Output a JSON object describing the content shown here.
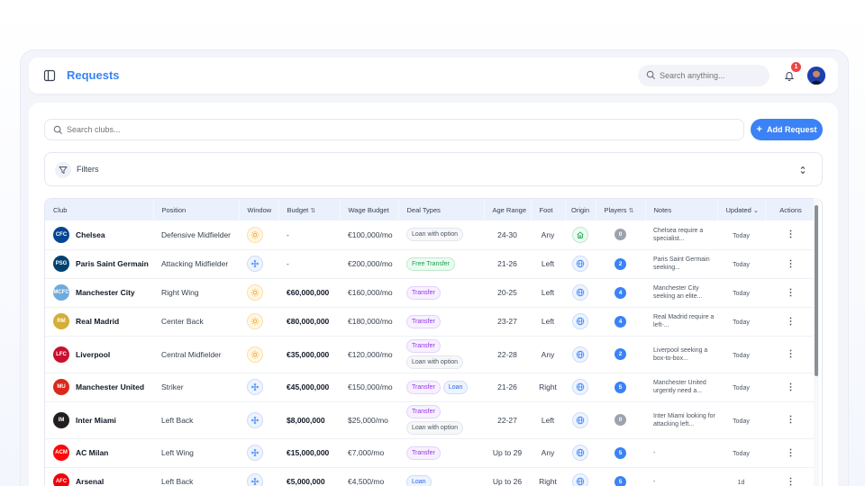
{
  "header": {
    "title": "Requests",
    "search_placeholder": "Search anything...",
    "notification_count": "1"
  },
  "toolbar": {
    "club_search_placeholder": "Search clubs...",
    "add_label": "Add Request",
    "filters_label": "Filters"
  },
  "table": {
    "columns": {
      "club": "Club",
      "position": "Position",
      "window": "Window",
      "budget": "Budget",
      "wage_budget": "Wage Budget",
      "deal_types": "Deal Types",
      "age_range": "Age Range",
      "foot": "Foot",
      "origin": "Origin",
      "players": "Players",
      "notes": "Notes",
      "updated": "Updated",
      "actions": "Actions"
    },
    "rows": [
      {
        "club": "Chelsea",
        "crest_color": "#034694",
        "crest_text": "CFC",
        "position": "Defensive Midfielder",
        "window": "summer",
        "budget": "-",
        "wage": "€100,000/mo",
        "deals": [
          "Loan with option"
        ],
        "age": "24-30",
        "foot": "Any",
        "origin": "home",
        "players": "0",
        "notes": "Chelsea require a specialist...",
        "updated": "Today"
      },
      {
        "club": "Paris Saint Germain",
        "crest_color": "#004170",
        "crest_text": "PSG",
        "position": "Attacking Midfielder",
        "window": "winter",
        "budget": "-",
        "wage": "€200,000/mo",
        "deals": [
          "Free Transfer"
        ],
        "age": "21-26",
        "foot": "Left",
        "origin": "globe",
        "players": "2",
        "notes": "Paris Saint Germain seeking...",
        "updated": "Today"
      },
      {
        "club": "Manchester City",
        "crest_color": "#6CABDD",
        "crest_text": "MCFC",
        "position": "Right Wing",
        "window": "summer",
        "budget": "€60,000,000",
        "wage": "€160,000/mo",
        "deals": [
          "Transfer"
        ],
        "age": "20-25",
        "foot": "Left",
        "origin": "globe",
        "players": "4",
        "notes": "Manchester City seeking an elite...",
        "updated": "Today"
      },
      {
        "club": "Real Madrid",
        "crest_color": "#d4af37",
        "crest_text": "RM",
        "position": "Center Back",
        "window": "summer",
        "budget": "€80,000,000",
        "wage": "€180,000/mo",
        "deals": [
          "Transfer"
        ],
        "age": "23-27",
        "foot": "Left",
        "origin": "globe",
        "players": "4",
        "notes": "Real Madrid require a left-...",
        "updated": "Today"
      },
      {
        "club": "Liverpool",
        "crest_color": "#c8102e",
        "crest_text": "LFC",
        "position": "Central Midfielder",
        "window": "summer",
        "budget": "€35,000,000",
        "wage": "€120,000/mo",
        "deals": [
          "Transfer",
          "Loan with option"
        ],
        "age": "22-28",
        "foot": "Any",
        "origin": "globe",
        "players": "2",
        "notes": "Liverpool seeking a box-to-box...",
        "updated": "Today"
      },
      {
        "club": "Manchester United",
        "crest_color": "#da291c",
        "crest_text": "MU",
        "position": "Striker",
        "window": "winter",
        "budget": "€45,000,000",
        "wage": "€150,000/mo",
        "deals": [
          "Transfer",
          "Loan"
        ],
        "age": "21-26",
        "foot": "Right",
        "origin": "globe",
        "players": "5",
        "notes": "Manchester United urgently need a...",
        "updated": "Today"
      },
      {
        "club": "Inter Miami",
        "crest_color": "#231f20",
        "crest_text": "IM",
        "position": "Left Back",
        "window": "winter",
        "budget": "$8,000,000",
        "wage": "$25,000/mo",
        "deals": [
          "Transfer",
          "Loan with option"
        ],
        "age": "22-27",
        "foot": "Left",
        "origin": "globe",
        "players": "0",
        "notes": "Inter Miami looking for attacking left...",
        "updated": "Today"
      },
      {
        "club": "AC Milan",
        "crest_color": "#fb090b",
        "crest_text": "ACM",
        "position": "Left Wing",
        "window": "winter",
        "budget": "€15,000,000",
        "wage": "€7,000/mo",
        "deals": [
          "Transfer"
        ],
        "age": "Up to 29",
        "foot": "Any",
        "origin": "globe",
        "players": "5",
        "notes": "-",
        "updated": "Today"
      },
      {
        "club": "Arsenal",
        "crest_color": "#ef0107",
        "crest_text": "AFC",
        "position": "Left Back",
        "window": "winter",
        "budget": "€5,000,000",
        "wage": "€4,500/mo",
        "deals": [
          "Loan"
        ],
        "age": "Up to 26",
        "foot": "Right",
        "origin": "globe",
        "players": "5",
        "notes": "-",
        "updated": "1d"
      }
    ]
  },
  "colors": {
    "accent": "#3b82f6",
    "badge": "#ef4444"
  },
  "icons": {
    "window_summer": "sun-icon",
    "window_winter": "snowflake-icon",
    "origin_home": "home-icon",
    "origin_globe": "globe-icon"
  }
}
